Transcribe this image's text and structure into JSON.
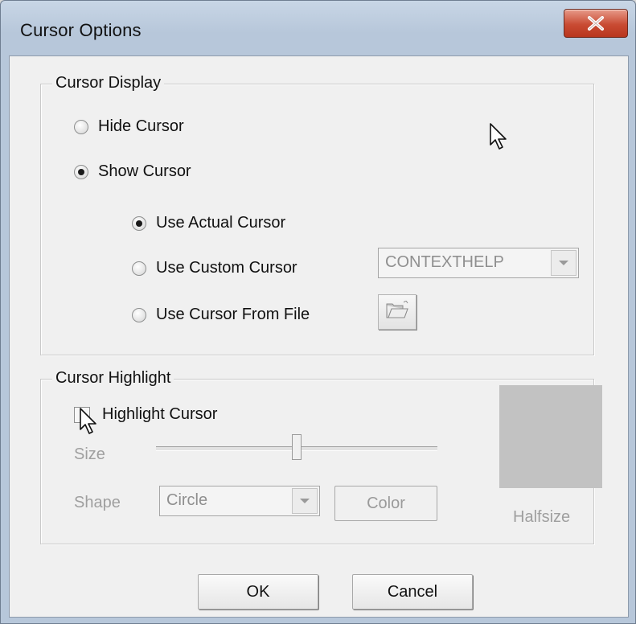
{
  "window": {
    "title": "Cursor Options"
  },
  "cursor_display": {
    "title": "Cursor Display",
    "hide_cursor": {
      "label": "Hide Cursor",
      "checked": false
    },
    "show_cursor": {
      "label": "Show Cursor",
      "checked": true
    },
    "use_actual_cursor": {
      "label": "Use Actual Cursor",
      "checked": true
    },
    "use_custom_cursor": {
      "label": "Use Custom Cursor",
      "checked": false
    },
    "use_cursor_from_file": {
      "label": "Use Cursor From File",
      "checked": false
    },
    "custom_cursor_select": {
      "value": "CONTEXTHELP",
      "enabled": false
    }
  },
  "cursor_highlight": {
    "title": "Cursor Highlight",
    "highlight_checkbox": {
      "label": "Highlight Cursor",
      "checked": false
    },
    "size_label": "Size",
    "shape_label": "Shape",
    "shape_select": {
      "value": "Circle",
      "enabled": false
    },
    "color_button": "Color",
    "preview_label": "Halfsize",
    "preview_color": "#c2c2c2"
  },
  "footer": {
    "ok_label": "OK",
    "cancel_label": "Cancel"
  },
  "icons": {
    "close": "close-icon",
    "folder": "open-folder-icon",
    "cursor": "mouse-pointer-icon"
  }
}
